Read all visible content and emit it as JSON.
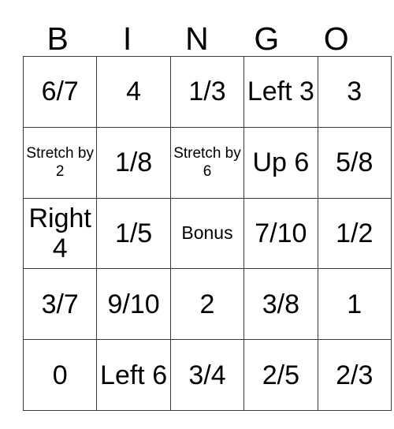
{
  "card": {
    "title": "BINGO",
    "headers": [
      "B",
      "I",
      "N",
      "G",
      "O"
    ],
    "border_color": "#3a3a3a",
    "background_color": "#ffffff",
    "text_color": "#000000",
    "columns": 5,
    "rows": 5,
    "cells": [
      [
        {
          "text": "6/7",
          "size": "lg"
        },
        {
          "text": "4",
          "size": "lg"
        },
        {
          "text": "1/3",
          "size": "lg"
        },
        {
          "text": "Left 3",
          "size": "lg"
        },
        {
          "text": "3",
          "size": "lg"
        }
      ],
      [
        {
          "text": "Stretch by 2",
          "size": "sm"
        },
        {
          "text": "1/8",
          "size": "lg"
        },
        {
          "text": "Stretch by 6",
          "size": "sm"
        },
        {
          "text": "Up 6",
          "size": "lg"
        },
        {
          "text": "5/8",
          "size": "lg"
        }
      ],
      [
        {
          "text": "Right 4",
          "size": "lg"
        },
        {
          "text": "1/5",
          "size": "lg"
        },
        {
          "text": "Bonus",
          "size": "md"
        },
        {
          "text": "7/10",
          "size": "lg"
        },
        {
          "text": "1/2",
          "size": "lg"
        }
      ],
      [
        {
          "text": "3/7",
          "size": "lg"
        },
        {
          "text": "9/10",
          "size": "lg"
        },
        {
          "text": "2",
          "size": "lg"
        },
        {
          "text": "3/8",
          "size": "lg"
        },
        {
          "text": "1",
          "size": "lg"
        }
      ],
      [
        {
          "text": "0",
          "size": "lg"
        },
        {
          "text": "Left 6",
          "size": "lg"
        },
        {
          "text": "3/4",
          "size": "lg"
        },
        {
          "text": "2/5",
          "size": "lg"
        },
        {
          "text": "2/3",
          "size": "lg"
        }
      ]
    ]
  }
}
